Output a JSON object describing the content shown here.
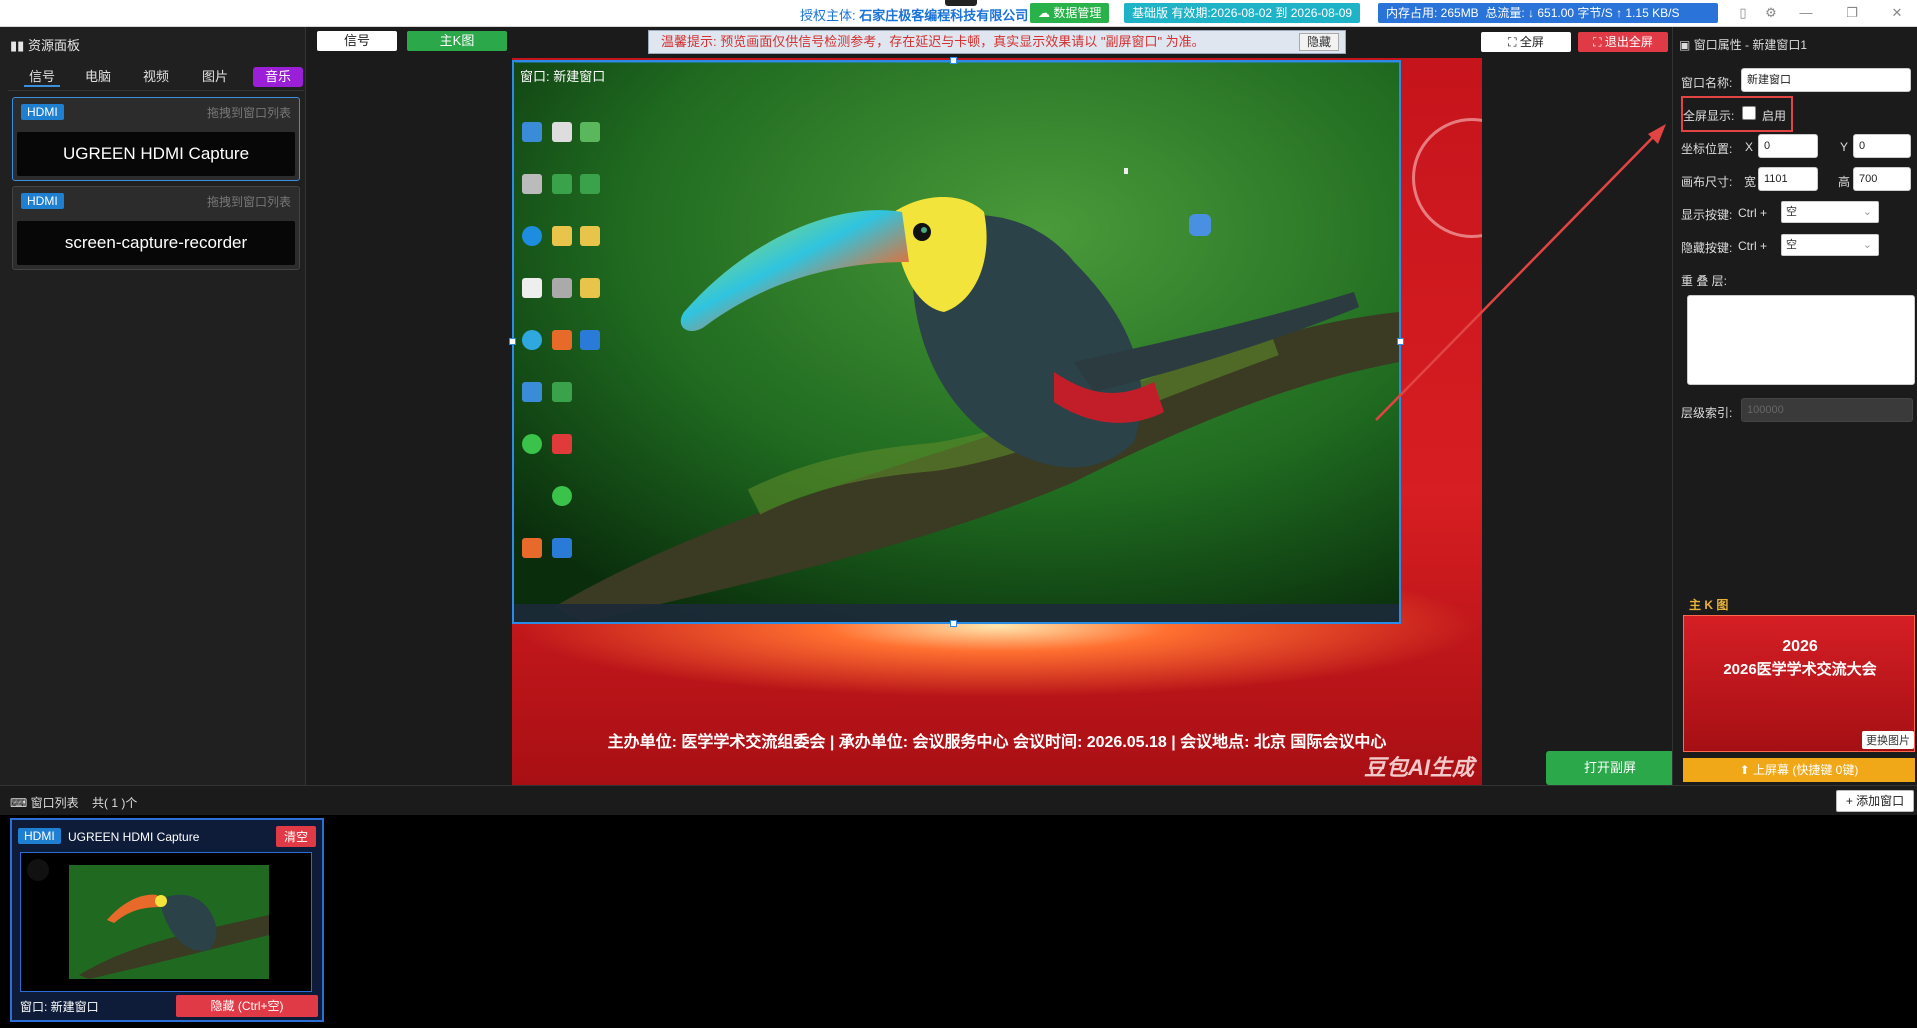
{
  "topbar": {
    "authorized_label": "授权主体:",
    "authorized_company": "石家庄极客编程科技有限公司",
    "data_mgmt": "数据管理",
    "edition": "基础版 有效期:2026-08-02 到 2026-08-09",
    "memory": "内存占用: 265MB",
    "traffic": "总流量: ↓ 651.00 字节/S   ↑ 1.15 KB/S",
    "colors": {
      "data_mgmt": "#29b24a",
      "edition": "#1fb3c8",
      "memory": "#2a73d8"
    }
  },
  "left": {
    "title": "资源面板",
    "tabs": [
      "信号",
      "电脑",
      "视频",
      "图片",
      "音乐"
    ],
    "sources": [
      {
        "tag": "HDMI",
        "hint": "拖拽到窗口列表",
        "name": "UGREEN HDMI Capture"
      },
      {
        "tag": "HDMI",
        "hint": "拖拽到窗口列表",
        "name": "screen-capture-recorder"
      }
    ]
  },
  "center": {
    "tab_signal": "信号",
    "tab_main_k": "主K图",
    "warning": "温馨提示: 预览画面仅供信号检测参考，存在延迟与卡顿，真实显示效果请以 \"副屏窗口\" 为准。",
    "warning_hide": "隐藏",
    "fullscreen": "全屏",
    "exit_fullscreen": "退出全屏",
    "preview_title": "窗口: 新建窗口",
    "stage_text": "主办单位: 医学学术交流组委会  |  承办单位: 会议服务中心        会议时间: 2026.05.18  |  会议地点: 北京 国际会议中心",
    "ai_mark": "豆包AI生成",
    "open_screen": "打开副屏"
  },
  "right": {
    "title": "窗口属性 - 新建窗口1",
    "name_label": "窗口名称:",
    "name_value": "新建窗口",
    "fullscreen_label": "全屏显示:",
    "fullscreen_enable": "启用",
    "pos_label": "坐标位置:",
    "x_label": "X",
    "x_value": "0",
    "y_label": "Y",
    "y_value": "0",
    "size_label": "画布尺寸:",
    "w_label": "宽",
    "w_value": "1101",
    "h_label": "高",
    "h_value": "700",
    "show_key_label": "显示按键:",
    "hide_key_label": "隐藏按键:",
    "ctrl_plus": "Ctrl +",
    "key_empty": "空",
    "overlay_label": "重 叠 层:",
    "layer_label": "层级索引:",
    "layer_value": "100000",
    "main_k_title": "主 K 图",
    "poster_year": "2026",
    "poster_title": "2026医学学术交流大会",
    "change_image": "更换图片",
    "upload_btn": "⬆ 上屏幕 (快捷键 0键)"
  },
  "bottom": {
    "list_title": "窗口列表",
    "count": "共( 1 )个",
    "add_window": "添加窗口",
    "card": {
      "tag": "HDMI",
      "name": "UGREEN HDMI Capture",
      "clear": "清空",
      "window_label": "窗口: 新建窗口",
      "hide": "隐藏 (Ctrl+空)"
    }
  }
}
